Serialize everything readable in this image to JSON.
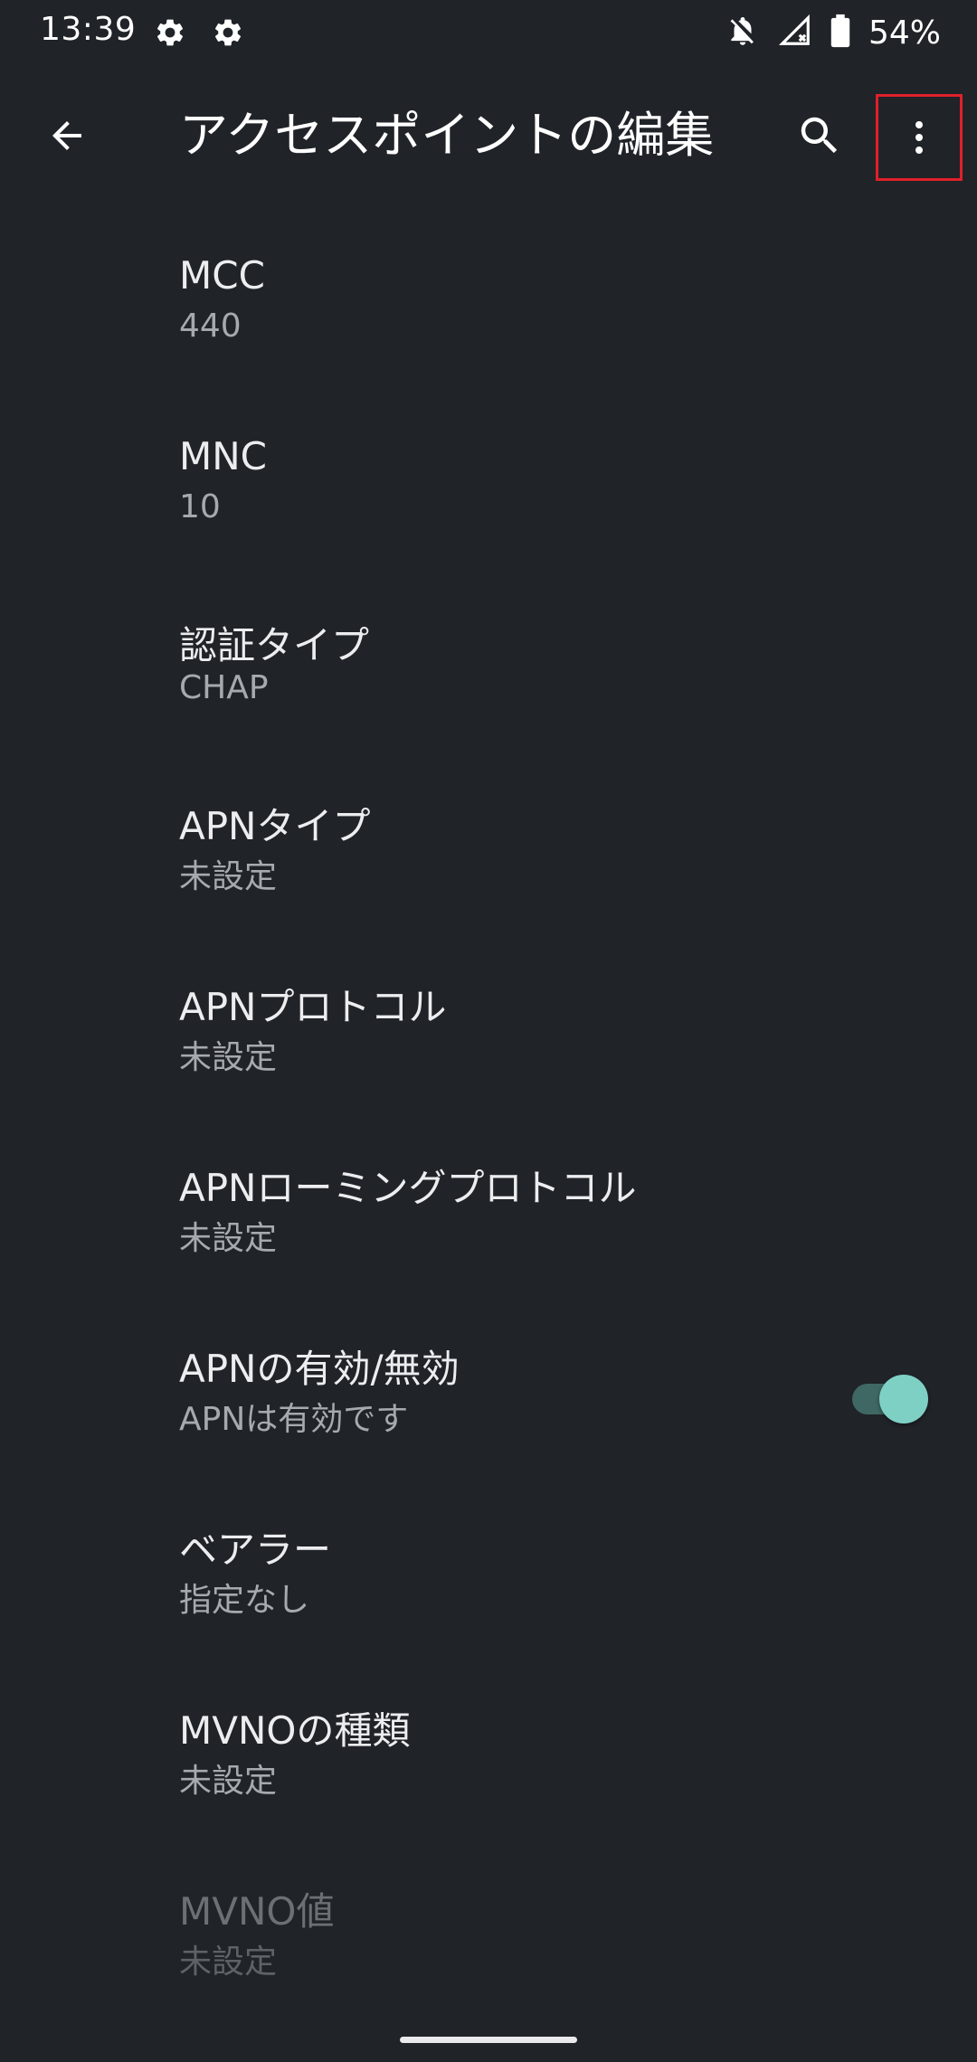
{
  "status_bar": {
    "time": "13:39",
    "icons": [
      "gear-icon",
      "gear-icon",
      "notifications-off-icon",
      "signal-no-service-icon",
      "battery-icon"
    ],
    "battery_percent": "54%"
  },
  "app_bar": {
    "title": "アクセスポイントの編集",
    "back_icon": "arrow-back-icon",
    "search_icon": "search-icon",
    "more_icon": "more-vert-icon",
    "highlight_color": "#e0202a"
  },
  "preferences": [
    {
      "title": "MCC",
      "summary": "440"
    },
    {
      "title": "MNC",
      "summary": "10"
    },
    {
      "title": "認証タイプ",
      "summary": "CHAP"
    },
    {
      "title": "APNタイプ",
      "summary": "未設定"
    },
    {
      "title": "APNプロトコル",
      "summary": "未設定"
    },
    {
      "title": "APNローミングプロトコル",
      "summary": "未設定"
    },
    {
      "title": "APNの有効/無効",
      "summary": "APNは有効です",
      "toggle_on": true
    },
    {
      "title": "ベアラー",
      "summary": "指定なし"
    },
    {
      "title": "MVNOの種類",
      "summary": "未設定"
    },
    {
      "title": "MVNO値",
      "summary": "未設定",
      "disabled": true
    }
  ],
  "colors": {
    "background": "#202328",
    "accent": "#7fd0c4"
  }
}
